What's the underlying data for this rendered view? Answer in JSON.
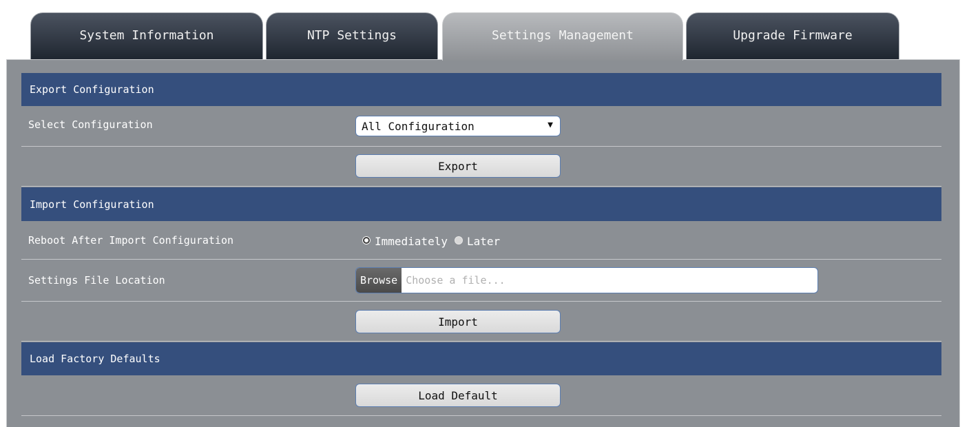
{
  "tabs": [
    {
      "label": "System Information",
      "active": false
    },
    {
      "label": "NTP Settings",
      "active": false
    },
    {
      "label": "Settings Management",
      "active": true
    },
    {
      "label": "Upgrade Firmware",
      "active": false
    }
  ],
  "export_section": {
    "title": "Export Configuration",
    "select_label": "Select Configuration",
    "select_value": "All Configuration",
    "export_button": "Export"
  },
  "import_section": {
    "title": "Import Configuration",
    "reboot_label": "Reboot After Import Configuration",
    "reboot_options": [
      {
        "label": "Immediately",
        "checked": true
      },
      {
        "label": "Later",
        "checked": false
      }
    ],
    "file_label": "Settings File Location",
    "browse_label": "Browse",
    "file_placeholder": "Choose a file...",
    "import_button": "Import"
  },
  "defaults_section": {
    "title": "Load Factory Defaults",
    "load_button": "Load Default"
  },
  "colors": {
    "panel": "#8b8f94",
    "section_header": "#354f7d",
    "tab_inactive": "#2a313b",
    "tab_active": "#a3a6aa",
    "button_border": "#5b7db0"
  }
}
